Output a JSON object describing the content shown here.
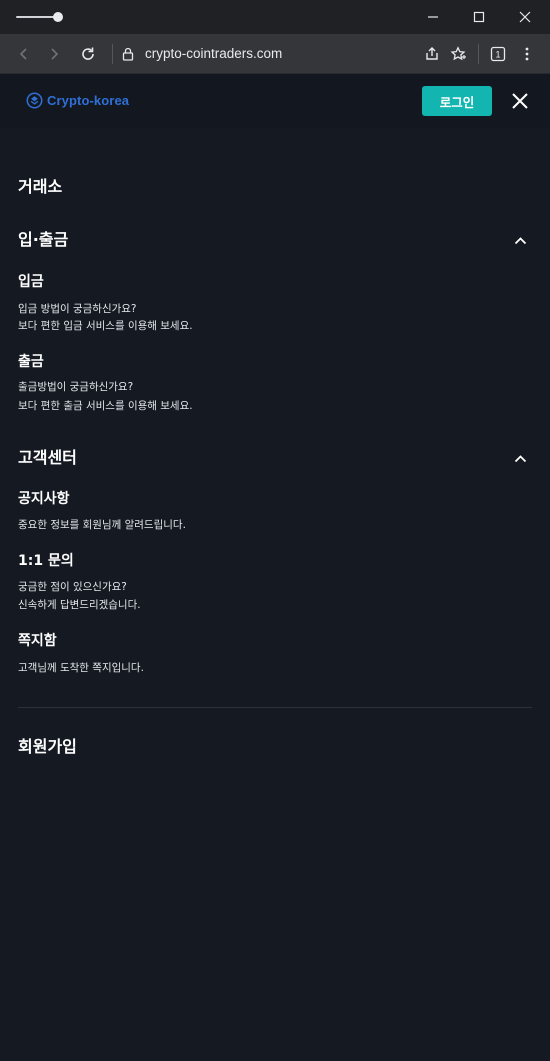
{
  "browser": {
    "url": "crypto-cointraders.com",
    "tab_count": "1"
  },
  "header": {
    "logo_text": "Crypto-korea",
    "login_label": "로그인"
  },
  "menu": {
    "exchange": "거래소",
    "deposit_withdraw": {
      "title": "입·출금",
      "deposit_title": "입금",
      "deposit_desc_1": "입금 방법이 궁금하신가요?",
      "deposit_desc_2": "보다 편한 입금 서비스를 이용해 보세요.",
      "withdraw_title": "출금",
      "withdraw_desc_1": "출금방법이 궁금하신가요?",
      "withdraw_desc_2": "보다 편한 출금 서비스를 이용해 보세요."
    },
    "customer_center": {
      "title": "고객센터",
      "notice_title": "공지사항",
      "notice_desc": "중요한 정보를 회원님께 알려드립니다.",
      "inquiry_title": "1:1 문의",
      "inquiry_desc_1": "궁금한 점이 있으신가요?",
      "inquiry_desc_2": "신속하게 답변드리겠습니다.",
      "message_title": "쪽지함",
      "message_desc": "고객님께 도착한 쪽지입니다."
    },
    "signup": "회원가입"
  },
  "colors": {
    "background": "#151a22",
    "accent": "#13b5b1",
    "logo": "#2f6fd6"
  }
}
